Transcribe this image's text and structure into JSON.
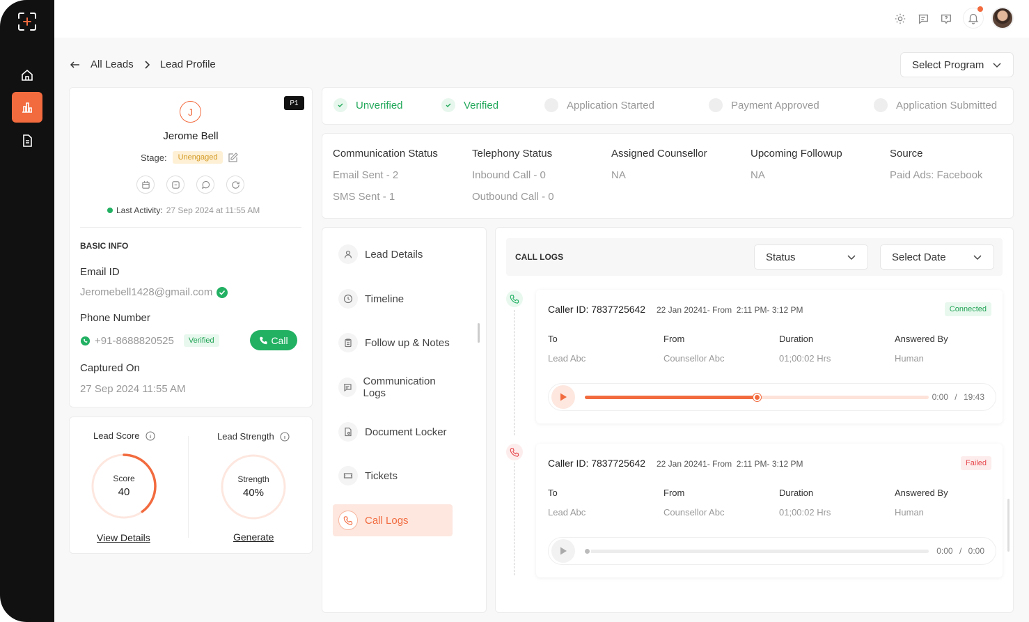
{
  "breadcrumb": {
    "parent": "All Leads",
    "current": "Lead Profile"
  },
  "program_select": {
    "label": "Select Program"
  },
  "profile": {
    "priority": "P1",
    "initial": "J",
    "name": "Jerome Bell",
    "stage_label": "Stage:",
    "stage_value": "Unengaged",
    "last_activity_label": "Last Activity:",
    "last_activity_value": "27 Sep 2024 at 11:55 AM"
  },
  "basic_info": {
    "section_title": "BASIC INFO",
    "email_label": "Email ID",
    "email_value": "Jeromebell1428@gmail.com",
    "phone_label": "Phone Number",
    "phone_value": "+91-8688820525",
    "phone_badge": "Verified",
    "call_label": "Call",
    "captured_label": "Captured On",
    "captured_value": "27 Sep 2024 11:55 AM"
  },
  "scores": {
    "score_title": "Lead Score",
    "score_inner_label": "Score",
    "score_value": "40",
    "score_fraction": 0.4,
    "view_details": "View Details",
    "strength_title": "Lead Strength",
    "strength_inner_label": "Strength",
    "strength_value": "40%",
    "generate": "Generate"
  },
  "stages": [
    {
      "label": "Unverified",
      "state": "done"
    },
    {
      "label": "Verified",
      "state": "done"
    },
    {
      "label": "Application Started",
      "state": "pending"
    },
    {
      "label": "Payment Approved",
      "state": "pending"
    },
    {
      "label": "Application Submitted",
      "state": "pending"
    }
  ],
  "summary": {
    "comm_title": "Communication Status",
    "comm_email": "Email Sent - 2",
    "comm_sms": "SMS Sent - 1",
    "tel_title": "Telephony Status",
    "tel_in": "Inbound Call - 0",
    "tel_out": "Outbound Call - 0",
    "counsellor_title": "Assigned Counsellor",
    "counsellor_value": "NA",
    "followup_title": "Upcoming Followup",
    "followup_value": "NA",
    "source_title": "Source",
    "source_value": "Paid Ads: Facebook"
  },
  "nav": [
    {
      "label": "Lead Details",
      "icon": "user-icon"
    },
    {
      "label": "Timeline",
      "icon": "clock-icon"
    },
    {
      "label": "Follow up & Notes",
      "icon": "clipboard-icon"
    },
    {
      "label": "Communication Logs",
      "icon": "chat-icon"
    },
    {
      "label": "Document Locker",
      "icon": "document-icon"
    },
    {
      "label": "Tickets",
      "icon": "ticket-icon"
    },
    {
      "label": "Call Logs",
      "icon": "phone-icon",
      "active": true
    }
  ],
  "call_logs": {
    "title": "CALL LOGS",
    "status_filter": "Status",
    "date_filter": "Select Date",
    "col_to": "To",
    "col_from": "From",
    "col_duration": "Duration",
    "col_answered": "Answered By",
    "entries": [
      {
        "caller": "Caller ID: 7837725642",
        "meta": "22 Jan 20241- From  2:11 PM- 3:12 PM",
        "status": "Connected",
        "to": "Lead Abc",
        "from": "Counsellor Abc",
        "duration": "01;00:02 Hrs",
        "answered_by": "Human",
        "current_time": "0:00",
        "total_time": "19:43",
        "progress": 0.5
      },
      {
        "caller": "Caller ID: 7837725642",
        "meta": "22 Jan 20241- From  2:11 PM- 3:12 PM",
        "status": "Failed",
        "to": "Lead Abc",
        "from": "Counsellor Abc",
        "duration": "01;00:02 Hrs",
        "answered_by": "Human",
        "current_time": "0:00",
        "total_time": "0:00",
        "progress": 0
      }
    ]
  },
  "colors": {
    "accent": "#f26b3f",
    "success": "#22b063",
    "danger": "#e5484d"
  }
}
